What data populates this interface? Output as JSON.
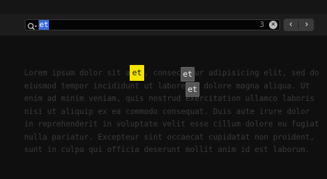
{
  "find_bar": {
    "search_value": "et",
    "match_count": "3",
    "clear_symbol": "✕",
    "prev_symbol": "‹",
    "next_symbol": "›"
  },
  "document": {
    "lines": [
      "Lorem ipsum dolor sit amet, consectetur adipisicing elit, sed do",
      "eiusmod tempor incididunt ut labore et dolore magna aliqua. Ut",
      "enim ad minim veniam, quis nostrud exercitation ullamco laboris",
      "nisi ut aliquip ex ea commodo consequat. Duis aute irure dolor",
      "in reprehenderit in voluptate velit esse cillum dolore eu fugiat",
      "nulla pariatur. Excepteur sint occaecat cupidatat non proident,",
      "sunt in culpa qui officia deserunt mollit anim id est laborum."
    ],
    "highlights": [
      "et",
      "et",
      "et"
    ]
  }
}
